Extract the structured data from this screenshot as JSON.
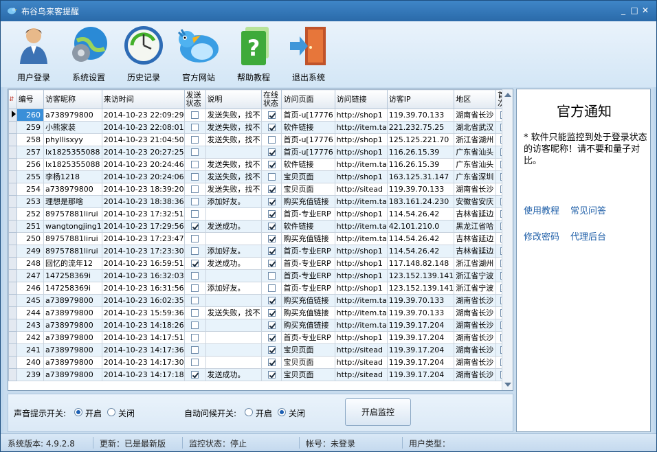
{
  "window": {
    "title": "布谷鸟来客提醒",
    "min": "_",
    "max": "□",
    "close": "✕"
  },
  "toolbar": [
    {
      "label": "用户登录",
      "icon": "user-login-icon"
    },
    {
      "label": "系统设置",
      "icon": "settings-globe-icon"
    },
    {
      "label": "历史记录",
      "icon": "history-clock-icon"
    },
    {
      "label": "官方网站",
      "icon": "cuckoo-bird-icon"
    },
    {
      "label": "帮助教程",
      "icon": "help-book-icon"
    },
    {
      "label": "退出系统",
      "icon": "exit-door-icon"
    }
  ],
  "grid": {
    "columns": [
      "编号",
      "访客昵称",
      "来访时间",
      "发送状态",
      "说明",
      "在线状态",
      "访问页面",
      "访问链接",
      "访客IP",
      "地区",
      "首次"
    ],
    "rows": [
      {
        "id": "260",
        "nick": "a738979800",
        "time": "2014-10-23 22:09:29",
        "sent": false,
        "note": "发送失败，找不",
        "online": true,
        "page": "首页-u[17776",
        "link": "http://shop1",
        "ip": "119.39.70.133",
        "region": "湖南省长沙",
        "first": false
      },
      {
        "id": "259",
        "nick": "小熊家装",
        "time": "2014-10-23 22:08:01",
        "sent": false,
        "note": "发送失败，找不",
        "online": true,
        "page": "软件链接",
        "link": "http://item.ta",
        "ip": "221.232.75.25",
        "region": "湖北省武汉",
        "first": true
      },
      {
        "id": "258",
        "nick": "phyllisxyy",
        "time": "2014-10-23 21:04:50",
        "sent": false,
        "note": "发送失败，找不",
        "online": false,
        "page": "首页-u[17776",
        "link": "http://shop1",
        "ip": "125.125.221.70",
        "region": "浙江省湖州",
        "first": true
      },
      {
        "id": "257",
        "nick": "lx1825355088",
        "time": "2014-10-23 20:27:25",
        "sent": false,
        "note": "",
        "online": true,
        "page": "首页-u[17776",
        "link": "http://shop1",
        "ip": "116.26.15.39",
        "region": "广东省汕头",
        "first": false
      },
      {
        "id": "256",
        "nick": "lx1825355088",
        "time": "2014-10-23 20:24:46",
        "sent": false,
        "note": "发送失败，找不",
        "online": true,
        "page": "软件链接",
        "link": "http://item.ta",
        "ip": "116.26.15.39",
        "region": "广东省汕头",
        "first": true
      },
      {
        "id": "255",
        "nick": "李杨1218",
        "time": "2014-10-23 20:24:06",
        "sent": false,
        "note": "发送失败，找不",
        "online": false,
        "page": "宝贝页面",
        "link": "http://shop1",
        "ip": "163.125.31.147",
        "region": "广东省深圳",
        "first": true
      },
      {
        "id": "254",
        "nick": "a738979800",
        "time": "2014-10-23 18:39:20",
        "sent": false,
        "note": "发送失败，找不",
        "online": true,
        "page": "宝贝页面",
        "link": "http://sitead",
        "ip": "119.39.70.133",
        "region": "湖南省长沙",
        "first": false
      },
      {
        "id": "253",
        "nick": "理想是那啥",
        "time": "2014-10-23 18:38:36",
        "sent": false,
        "note": "添加好友。",
        "online": true,
        "page": "购买充值链接",
        "link": "http://item.ta",
        "ip": "183.161.24.230",
        "region": "安徽省安庆",
        "first": true
      },
      {
        "id": "252",
        "nick": "89757881lirui",
        "time": "2014-10-23 17:32:51",
        "sent": false,
        "note": "",
        "online": true,
        "page": "首页-专业ERP",
        "link": "http://shop1",
        "ip": "114.54.26.42",
        "region": "吉林省延边",
        "first": false
      },
      {
        "id": "251",
        "nick": "wangtongjing1",
        "time": "2014-10-23 17:29:56",
        "sent": true,
        "note": "发送成功。",
        "online": true,
        "page": "软件链接",
        "link": "http://item.ta",
        "ip": "42.101.210.0",
        "region": "黑龙江省哈",
        "first": true
      },
      {
        "id": "250",
        "nick": "89757881lirui",
        "time": "2014-10-23 17:23:47",
        "sent": false,
        "note": "",
        "online": true,
        "page": "购买充值链接",
        "link": "http://item.ta",
        "ip": "114.54.26.42",
        "region": "吉林省延边",
        "first": false
      },
      {
        "id": "249",
        "nick": "89757881lirui",
        "time": "2014-10-23 17:23:30",
        "sent": false,
        "note": "添加好友。",
        "online": true,
        "page": "首页-专业ERP",
        "link": "http://shop1",
        "ip": "114.54.26.42",
        "region": "吉林省延边",
        "first": true
      },
      {
        "id": "248",
        "nick": "回忆的流年12",
        "time": "2014-10-23 16:59:51",
        "sent": true,
        "note": "发送成功。",
        "online": true,
        "page": "首页-专业ERP",
        "link": "http://shop1",
        "ip": "117.148.82.148",
        "region": "浙江省湖州",
        "first": true
      },
      {
        "id": "247",
        "nick": "147258369i",
        "time": "2014-10-23 16:32:03",
        "sent": false,
        "note": "",
        "online": false,
        "page": "首页-专业ERP",
        "link": "http://shop1",
        "ip": "123.152.139.141",
        "region": "浙江省宁波",
        "first": false
      },
      {
        "id": "246",
        "nick": "147258369i",
        "time": "2014-10-23 16:31:56",
        "sent": false,
        "note": "添加好友。",
        "online": false,
        "page": "首页-专业ERP",
        "link": "http://shop1",
        "ip": "123.152.139.141",
        "region": "浙江省宁波",
        "first": true
      },
      {
        "id": "245",
        "nick": "a738979800",
        "time": "2014-10-23 16:02:35",
        "sent": false,
        "note": "",
        "online": true,
        "page": "购买充值链接",
        "link": "http://item.ta",
        "ip": "119.39.70.133",
        "region": "湖南省长沙",
        "first": false
      },
      {
        "id": "244",
        "nick": "a738979800",
        "time": "2014-10-23 15:59:36",
        "sent": false,
        "note": "发送失败，找不",
        "online": true,
        "page": "购买充值链接",
        "link": "http://item.ta",
        "ip": "119.39.70.133",
        "region": "湖南省长沙",
        "first": false
      },
      {
        "id": "243",
        "nick": "a738979800",
        "time": "2014-10-23 14:18:26",
        "sent": false,
        "note": "",
        "online": true,
        "page": "购买充值链接",
        "link": "http://item.ta",
        "ip": "119.39.17.204",
        "region": "湖南省长沙",
        "first": false
      },
      {
        "id": "242",
        "nick": "a738979800",
        "time": "2014-10-23 14:17:51",
        "sent": false,
        "note": "",
        "online": true,
        "page": "首页-专业ERP",
        "link": "http://shop1",
        "ip": "119.39.17.204",
        "region": "湖南省长沙",
        "first": false
      },
      {
        "id": "241",
        "nick": "a738979800",
        "time": "2014-10-23 14:17:36",
        "sent": false,
        "note": "",
        "online": true,
        "page": "宝贝页面",
        "link": "http://sitead",
        "ip": "119.39.17.204",
        "region": "湖南省长沙",
        "first": false
      },
      {
        "id": "240",
        "nick": "a738979800",
        "time": "2014-10-23 14:17:30",
        "sent": false,
        "note": "",
        "online": true,
        "page": "宝贝页面",
        "link": "http://sitead",
        "ip": "119.39.17.204",
        "region": "湖南省长沙",
        "first": false
      },
      {
        "id": "239",
        "nick": "a738979800",
        "time": "2014-10-23 14:17:18",
        "sent": true,
        "note": "发送成功。",
        "online": true,
        "page": "宝贝页面",
        "link": "http://sitead",
        "ip": "119.39.17.204",
        "region": "湖南省长沙",
        "first": false
      }
    ]
  },
  "notice": {
    "title": "官方通知",
    "text": "* 软件只能监控到处于登录状态的访客昵称！请不要和量子对比。",
    "links": [
      "使用教程",
      "常见问答",
      "修改密码",
      "代理后台"
    ]
  },
  "options": {
    "sound_label": "声音提示开关:",
    "sound_on": "开启",
    "sound_off": "关闭",
    "greet_label": "自动问候开关:",
    "greet_on": "开启",
    "greet_off": "关闭",
    "monitor_button": "开启监控"
  },
  "status": {
    "version": "系统版本: 4.9.2.8",
    "update": "更新：已是最新版",
    "monitor": "监控状态：停止",
    "account": "帐号：未登录",
    "user_type": "用户类型："
  },
  "colors": {
    "titlebar": "#2f74b6",
    "accent": "#3b8fd8",
    "link": "#1f5fa8"
  }
}
